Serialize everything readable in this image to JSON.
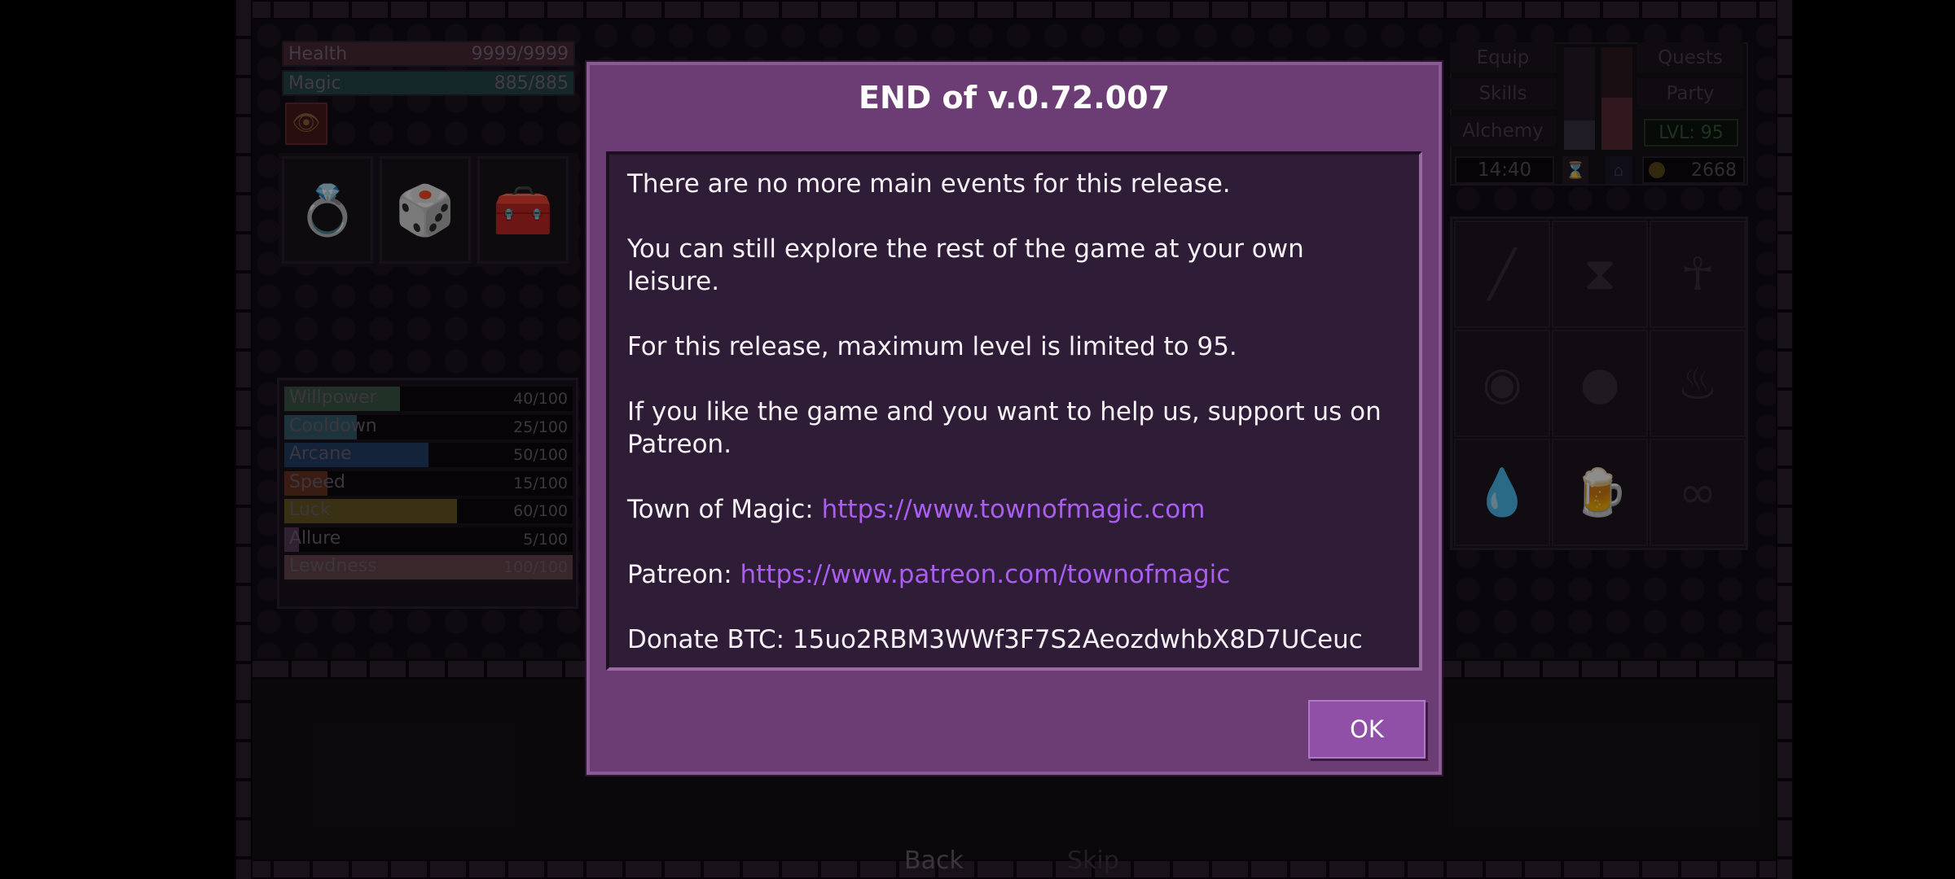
{
  "left_panel": {
    "health": {
      "label": "Health",
      "value": "9999/9999",
      "fill": 1.0
    },
    "magic": {
      "label": "Magic",
      "value": "885/885",
      "fill": 1.0
    },
    "slots": [
      {
        "icon": "ring-icon"
      },
      {
        "icon": "dice-icon"
      },
      {
        "icon": "chest-icon"
      }
    ],
    "stats": [
      {
        "name": "Willpower",
        "value": "40/100",
        "fill": 0.4,
        "color": "#3d5a48"
      },
      {
        "name": "Cooldown",
        "value": "25/100",
        "fill": 0.25,
        "color": "#36606e"
      },
      {
        "name": "Arcane",
        "value": "50/100",
        "fill": 0.5,
        "color": "#24406a"
      },
      {
        "name": "Speed",
        "value": "15/100",
        "fill": 0.15,
        "color": "#6a3424"
      },
      {
        "name": "Luck",
        "value": "60/100",
        "fill": 0.6,
        "color": "#6a5a26"
      },
      {
        "name": "Allure",
        "value": "5/100",
        "fill": 0.05,
        "color": "#5a3a5c"
      },
      {
        "name": "Lewdness",
        "value": "100/100",
        "fill": 1.0,
        "color": "#6a4850"
      }
    ]
  },
  "right_panel": {
    "buttons": {
      "equip": "Equip",
      "skills": "Skills",
      "alchemy": "Alchemy",
      "quests": "Quests",
      "party": "Party"
    },
    "level": "LVL: 95",
    "time": "14:40",
    "gold": "2668",
    "inventory": [
      {
        "icon": "wand-icon"
      },
      {
        "icon": "hourglass-icon"
      },
      {
        "icon": "amulet-icon"
      },
      {
        "icon": "eye-orb-icon"
      },
      {
        "icon": "eight-ball-icon"
      },
      {
        "icon": "lamp-icon"
      },
      {
        "icon": "blood-drop-icon"
      },
      {
        "icon": "beer-mug-icon"
      },
      {
        "icon": "goggles-icon"
      }
    ]
  },
  "bottom": {
    "back": "Back",
    "skip": "Skip"
  },
  "dialog": {
    "title": "END of v.0.72.007",
    "p1": "There are no more main events for this release.",
    "p2": "You can still explore the rest of the game at your own leisure.",
    "p3": "For this release, maximum level is limited to 95.",
    "p4": "If you like the game and you want to help us, support us on Patreon.",
    "town_label": "Town of Magic: ",
    "town_url": "https://www.townofmagic.com",
    "patreon_label": "Patreon: ",
    "patreon_url": "https://www.patreon.com/townofmagic",
    "btc": "Donate BTC: 15uo2RBM3WWf3F7S2AeozdwhbX8D7UCeuc",
    "ok": "OK"
  },
  "colors": {
    "dialog_bg": "#6c3c74",
    "link": "#a95ef0",
    "ok_button": "#9050a8"
  }
}
